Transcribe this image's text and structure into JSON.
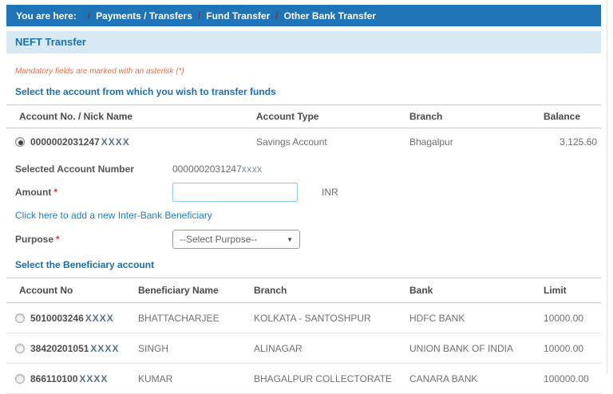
{
  "colors": {
    "breadcrumb_bar": "#1f73b7",
    "breadcrumb_separator": "#8f2c35",
    "panel_header_bg": "#d9e9f3",
    "heading_blue": "#1a6fae",
    "mandatory_orange": "#f26a3d",
    "link_blue": "#1e7ec8",
    "required_red": "#e03a2f",
    "input_border_blue": "#8cc6ec"
  },
  "breadcrumb": {
    "prefix": "You are here:",
    "separator": "/",
    "items": [
      "Payments / Transfers",
      "Fund Transfer",
      "Other Bank Transfer"
    ]
  },
  "page": {
    "title": "NEFT Transfer",
    "mandatory_note": "Mandatory fields are marked with an asterisk (*)"
  },
  "source_section": {
    "heading": "Select the account from which you wish to transfer funds",
    "table": {
      "headers": [
        "Account No. / Nick Name",
        "Account Type",
        "Branch",
        "Balance"
      ],
      "rows": [
        {
          "account": "0000002031247",
          "masked": "XXXX",
          "type": "Savings Account",
          "branch": "Bhagalpur",
          "balance": "3,125.60"
        }
      ]
    }
  },
  "form": {
    "required_marker": "*",
    "selected_account_label": "Selected Account Number",
    "selected_account_value": "0000002031247",
    "selected_account_masked": "xxxx",
    "amount_label": "Amount",
    "amount_value": "",
    "currency": "INR",
    "add_beneficiary_link": "Click here to add a new Inter-Bank Beneficiary",
    "purpose_label": "Purpose",
    "purpose_selected": "--Select Purpose--",
    "dropdown_caret": "▼"
  },
  "beneficiary_section": {
    "heading": "Select the Beneficiary account",
    "table": {
      "headers": [
        "Account No",
        "Beneficiary Name",
        "Branch",
        "Bank",
        "Limit"
      ],
      "rows": [
        {
          "account": "5010003246",
          "masked": "XXXX",
          "name": "BHATTACHARJEE",
          "branch": "KOLKATA - SANTOSHPUR",
          "bank": "HDFC BANK",
          "limit": "10000.00"
        },
        {
          "account": "38420201051",
          "masked": "XXXX",
          "name": "SINGH",
          "branch": "ALINAGAR",
          "bank": "UNION BANK OF INDIA",
          "limit": "10000.00"
        },
        {
          "account": "866110100",
          "masked": "XXXX",
          "name": "KUMAR",
          "branch": "BHAGALPUR COLLECTORATE",
          "bank": "CANARA BANK",
          "limit": "100000.00"
        }
      ]
    }
  }
}
